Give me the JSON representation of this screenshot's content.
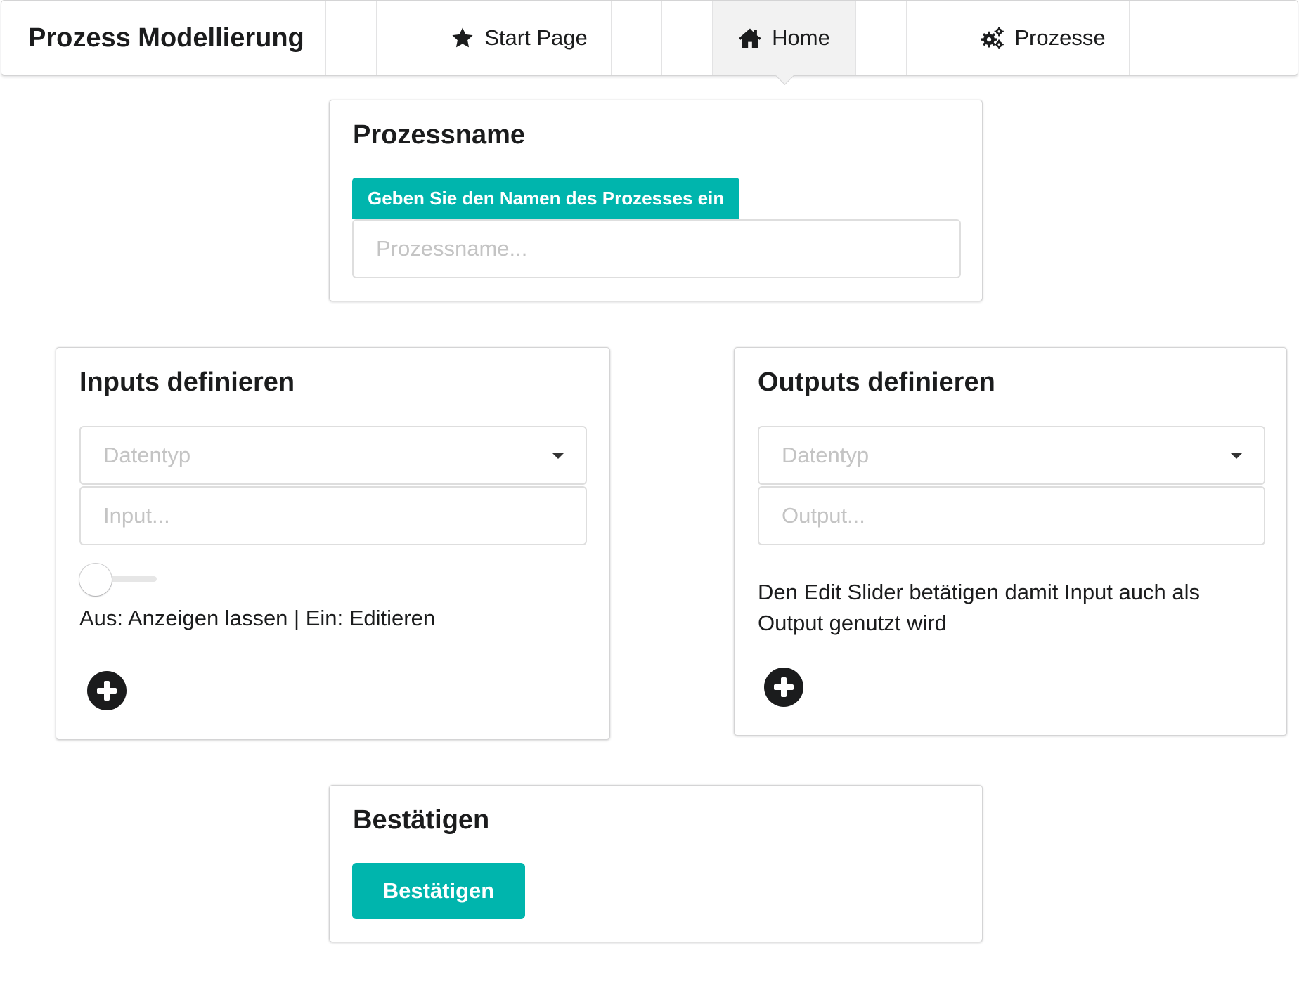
{
  "nav": {
    "brand": "Prozess Modellierung",
    "items": [
      {
        "label": "Start Page",
        "icon": "star-icon"
      },
      {
        "label": "Home",
        "icon": "home-icon",
        "active": true
      },
      {
        "label": "Prozesse",
        "icon": "cogs-icon"
      }
    ]
  },
  "process_name_card": {
    "title": "Prozessname",
    "label": "Geben Sie den Namen des Prozesses ein",
    "placeholder": "Prozessname..."
  },
  "inputs_card": {
    "title": "Inputs definieren",
    "datatype_placeholder": "Datentyp",
    "input_placeholder": "Input...",
    "toggle_on": false,
    "toggle_caption": "Aus: Anzeigen lassen | Ein: Editieren",
    "add_icon": "plus-circle-icon"
  },
  "outputs_card": {
    "title": "Outputs definieren",
    "datatype_placeholder": "Datentyp",
    "output_placeholder": "Output...",
    "hint_line1": "Den Edit Slider betätigen damit Input auch als",
    "hint_line2": "Output genutzt wird",
    "add_icon": "plus-circle-icon"
  },
  "confirm_card": {
    "title": "Bestätigen",
    "button_label": "Bestätigen"
  },
  "colors": {
    "accent": "#00b5ad",
    "text": "#1b1c1d",
    "border": "#d4d4d5",
    "active_menu_bg": "#f2f2f2"
  }
}
